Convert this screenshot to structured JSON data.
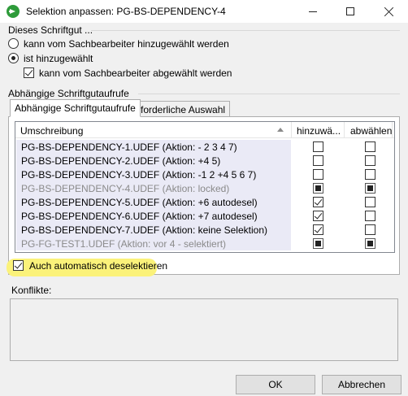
{
  "window": {
    "title": "Selektion anpassen: PG-BS-DEPENDENCY-4",
    "icon": "green-arrow-icon"
  },
  "group_top": {
    "label": "Dieses Schriftgut ...",
    "radio1": "kann vom Sachbearbeiter hinzugewählt werden",
    "radio2": "ist hinzugewählt",
    "checkbox": "kann vom Sachbearbeiter abgewählt werden"
  },
  "group_deps": {
    "label": "Abhängige Schriftgutaufrufe",
    "tabs": [
      "Abhängige Schriftgutaufrufe",
      "Erforderliche Auswahl"
    ]
  },
  "list": {
    "columns": [
      "Umschreibung",
      "hinzuwä...",
      "abwählen"
    ],
    "rows": [
      {
        "name": "PG-BS-DEPENDENCY-1.UDEF (Aktion: -  2 3 4 7)",
        "disabled": false,
        "add": "unchecked",
        "remove": "unchecked"
      },
      {
        "name": "PG-BS-DEPENDENCY-2.UDEF (Aktion: +4 5)",
        "disabled": false,
        "add": "unchecked",
        "remove": "unchecked"
      },
      {
        "name": "PG-BS-DEPENDENCY-3.UDEF (Aktion: -1 2  +4 5 6 7)",
        "disabled": false,
        "add": "unchecked",
        "remove": "unchecked"
      },
      {
        "name": "PG-BS-DEPENDENCY-4.UDEF (Aktion: locked)",
        "disabled": true,
        "add": "indeterminate",
        "remove": "indeterminate"
      },
      {
        "name": "PG-BS-DEPENDENCY-5.UDEF (Aktion: +6 autodesel)",
        "disabled": false,
        "add": "checked",
        "remove": "unchecked"
      },
      {
        "name": "PG-BS-DEPENDENCY-6.UDEF (Aktion: +7 autodesel)",
        "disabled": false,
        "add": "checked",
        "remove": "unchecked"
      },
      {
        "name": "PG-BS-DEPENDENCY-7.UDEF (Aktion: keine Selektion)",
        "disabled": false,
        "add": "checked",
        "remove": "unchecked"
      },
      {
        "name": "PG-FG-TEST1.UDEF (Aktion: vor 4 - selektiert)",
        "disabled": true,
        "add": "indeterminate",
        "remove": "indeterminate"
      }
    ]
  },
  "auto_deselect": {
    "label": "Auch automatisch deselektieren",
    "checked": true
  },
  "conflicts": {
    "label": "Konflikte:"
  },
  "buttons": {
    "ok": "OK",
    "cancel": "Abbrechen"
  },
  "colors": {
    "highlight": "#fbf27a",
    "row_background": "#eaeaf6",
    "disabled_text": "#8a8a8a"
  }
}
